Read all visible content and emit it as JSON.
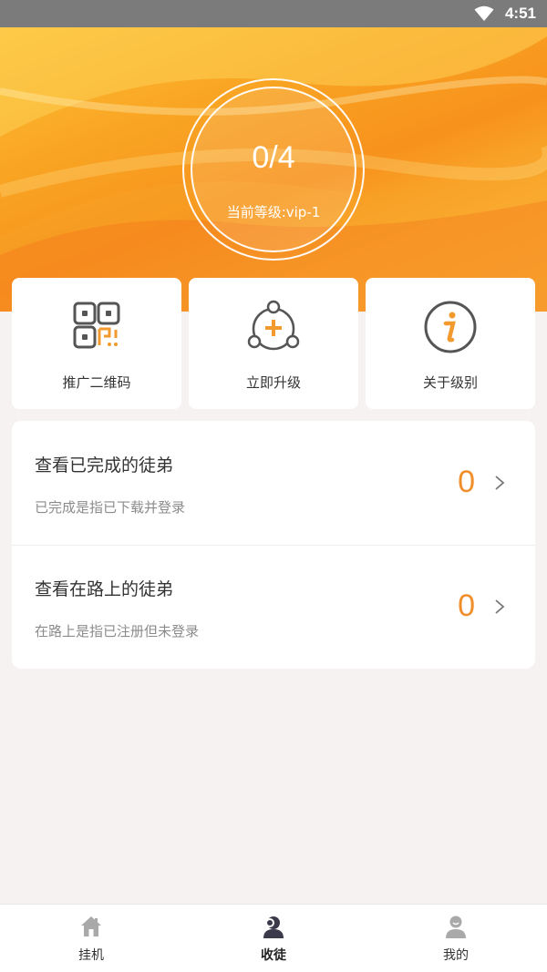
{
  "status_bar": {
    "time": "4:51",
    "icon": "wifi-icon"
  },
  "hero": {
    "progress": "0/4",
    "level": "当前等级:vip-1",
    "colors": {
      "primary": "#f7921c",
      "light": "#fdc33a"
    }
  },
  "actions": [
    {
      "label": "推广二维码",
      "icon": "qr-code-icon"
    },
    {
      "label": "立即升级",
      "icon": "upgrade-icon"
    },
    {
      "label": "关于级别",
      "icon": "info-icon"
    }
  ],
  "apprentices": [
    {
      "title": "查看已完成的徒弟",
      "desc": "已完成是指已下载并登录",
      "count": "0"
    },
    {
      "title": "查看在路上的徒弟",
      "desc": "在路上是指已注册但未登录",
      "count": "0"
    }
  ],
  "accent_color": "#f08e2a",
  "tabs": [
    {
      "label": "挂机",
      "icon": "home-icon"
    },
    {
      "label": "收徒",
      "icon": "apprentice-icon",
      "active": true
    },
    {
      "label": "我的",
      "icon": "profile-icon"
    }
  ]
}
